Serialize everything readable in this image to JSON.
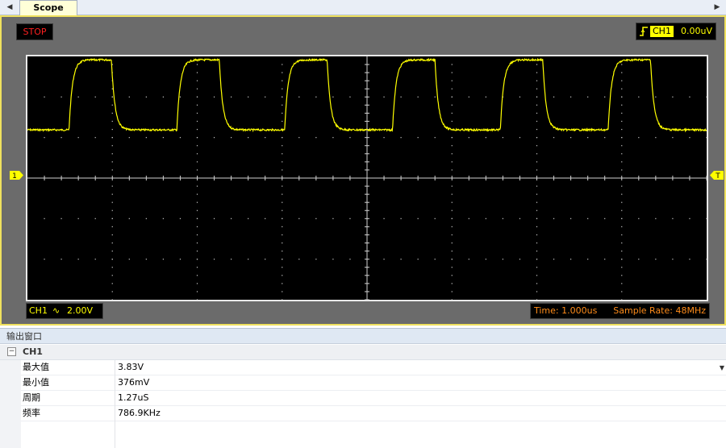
{
  "tabbar": {
    "left_arrow": "◀",
    "right_arrow": "▶",
    "tab_label": "Scope"
  },
  "scope": {
    "status": "STOP",
    "trigger": {
      "channel": "CH1",
      "level": "0.00uV",
      "edge": "rising-edge-icon"
    },
    "channel_marker": "1",
    "trigger_marker": "T",
    "bottom": {
      "channel": "CH1",
      "coupling_symbol": "∿",
      "volts_per_div": "2.00V",
      "time": "Time: 1.000us",
      "sample_rate": "Sample Rate: 48MHz"
    },
    "colors": {
      "trace": "#ffff00",
      "readout": "#ff8c1a",
      "stop": "#ff2020",
      "frame": "#efe15e"
    },
    "grid": {
      "h_divisions": 8,
      "v_divisions": 6,
      "center_ticks": true
    }
  },
  "chart_data": {
    "type": "line",
    "title": "",
    "xlabel": "",
    "ylabel": "",
    "xlim_us": [
      0,
      8
    ],
    "ylim_v": [
      -8,
      4
    ],
    "series": [
      {
        "name": "CH1",
        "high_v": 3.83,
        "low_v": 0.376,
        "period_us": 1.27,
        "first_rising_edge_us": 0.49,
        "high_duration_us": 0.5
      }
    ]
  },
  "output": {
    "title": "输出窗口",
    "group": "CH1",
    "collapse_symbol": "−",
    "rows": [
      {
        "name": "最大值",
        "value": "3.83V"
      },
      {
        "name": "最小值",
        "value": "376mV"
      },
      {
        "name": "周期",
        "value": "1.27uS"
      },
      {
        "name": "频率",
        "value": "786.9KHz"
      }
    ]
  }
}
